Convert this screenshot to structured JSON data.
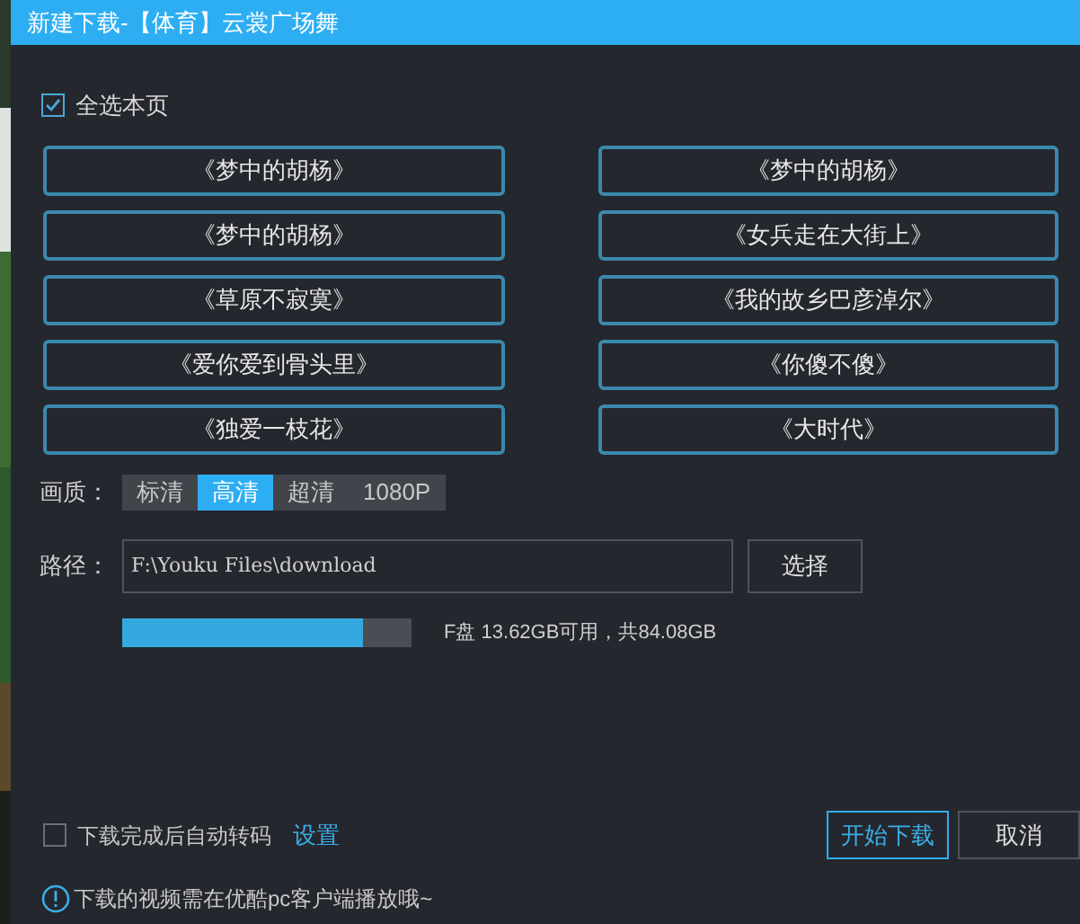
{
  "window": {
    "title": "新建下载-【体育】云裳广场舞"
  },
  "select_all": {
    "label": "全选本页",
    "checked": true
  },
  "episodes": [
    {
      "title": "《梦中的胡杨》"
    },
    {
      "title": "《梦中的胡杨》"
    },
    {
      "title": "《梦中的胡杨》"
    },
    {
      "title": "《女兵走在大街上》"
    },
    {
      "title": "《草原不寂寞》"
    },
    {
      "title": "《我的故乡巴彦淖尔》"
    },
    {
      "title": "《爱你爱到骨头里》"
    },
    {
      "title": "《你傻不傻》"
    },
    {
      "title": "《独爱一枝花》"
    },
    {
      "title": "《大时代》"
    }
  ],
  "quality": {
    "label": "画质：",
    "options": [
      {
        "label": "标清",
        "selected": false
      },
      {
        "label": "高清",
        "selected": true
      },
      {
        "label": "超清",
        "selected": false
      },
      {
        "label": "1080P",
        "selected": false
      }
    ]
  },
  "path": {
    "label": "路径：",
    "value": "F:\\Youku Files\\download",
    "button": "选择"
  },
  "disk": {
    "level": 0.83,
    "reading": "F盘 13.62GB可用，共84.08GB"
  },
  "auto_transcode": {
    "label": "下载完成后自动转码",
    "checked": false,
    "link": "设置"
  },
  "buttons": [
    {
      "label": "开始下载",
      "kind": "primary"
    },
    {
      "label": "取消",
      "kind": "secondary"
    }
  ],
  "notice": "下载的视频需在优酷pc客户端播放哦~"
}
